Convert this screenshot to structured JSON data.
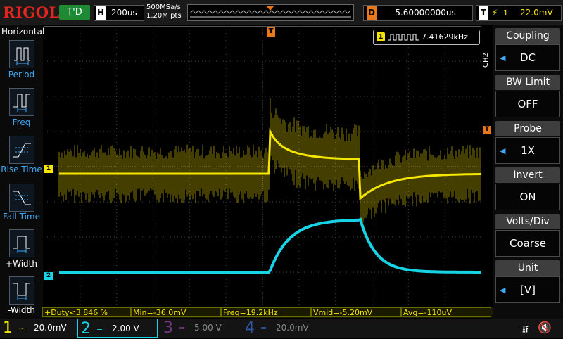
{
  "header": {
    "logo": "RIGOL",
    "run_status": "T'D",
    "horizontal_label": "H",
    "timebase": "200us",
    "sample_rate": "500MSa/s",
    "memory_depth": "1.20M pts",
    "delay_label": "D",
    "delay": "-5.60000000us",
    "trigger_label": "T",
    "trigger_source": "1",
    "trigger_level": "22.0mV"
  },
  "left_panel": {
    "title": "Horizontal",
    "items": [
      {
        "label": "Period",
        "icon": "period-icon"
      },
      {
        "label": "Freq",
        "icon": "freq-icon"
      },
      {
        "label": "Rise Time",
        "icon": "rise-time-icon"
      },
      {
        "label": "Fall Time",
        "icon": "fall-time-icon"
      },
      {
        "label": "+Width",
        "icon": "positive-width-icon"
      },
      {
        "label": "-Width",
        "icon": "negative-width-icon"
      }
    ]
  },
  "frequency_counter": {
    "channel": "1",
    "value": "7.41629kHz"
  },
  "plot": {
    "ch1_marker": "1",
    "ch2_marker": "2",
    "trigger_marker": "T"
  },
  "right_menu": {
    "channel_tag": "CH2",
    "items": [
      {
        "title": "Coupling",
        "value": "DC"
      },
      {
        "title": "BW Limit",
        "value": "OFF"
      },
      {
        "title": "Probe",
        "value": "1X"
      },
      {
        "title": "Invert",
        "value": "ON"
      },
      {
        "title": "Volts/Div",
        "value": "Coarse"
      },
      {
        "title": "Unit",
        "value": "[V]"
      }
    ]
  },
  "measurements": [
    "+Duty<3.846 %",
    "Min=-36.0mV",
    "Freq=19.2kHz",
    "Vmid=-5.20mV",
    "Avg=-110uV"
  ],
  "channels": [
    {
      "number": "1",
      "coupling": "~",
      "scale": "20.0mV",
      "color": "#f5e600"
    },
    {
      "number": "2",
      "coupling": "=",
      "scale": "2.00 V",
      "color": "#16d4e6"
    },
    {
      "number": "3",
      "coupling": "=",
      "scale": "5.00 V",
      "color": "#c03ad0"
    },
    {
      "number": "4",
      "coupling": "=",
      "scale": "20.0mV",
      "color": "#2f6fe0"
    }
  ],
  "colors": {
    "ch1": "#f5e600",
    "ch2": "#16d4e6",
    "trigger": "#e8781a",
    "accent_blue": "#3fa9f5"
  }
}
